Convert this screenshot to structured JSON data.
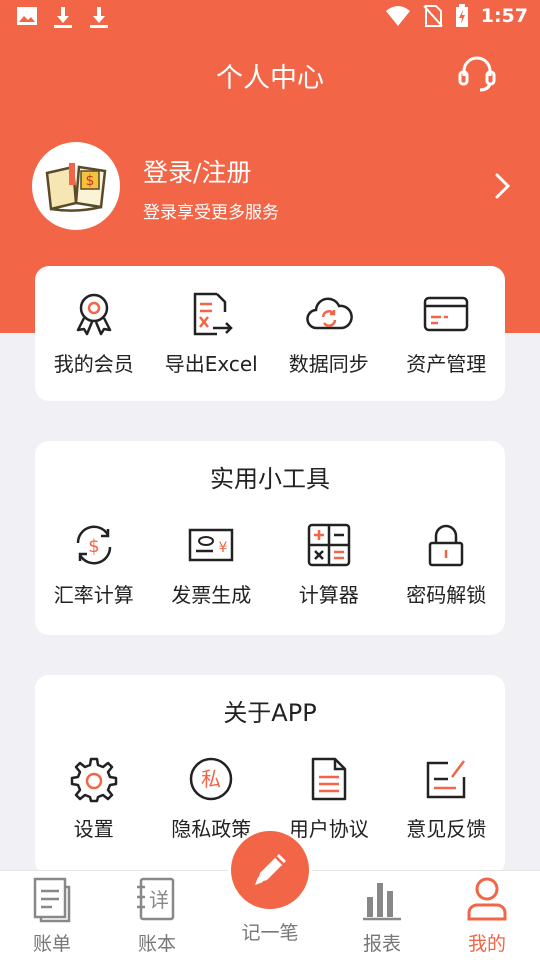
{
  "status_bar": {
    "time": "1:57"
  },
  "header": {
    "title": "个人中心"
  },
  "profile": {
    "login_label": "登录/注册",
    "login_sub": "登录享受更多服务"
  },
  "quick_actions": [
    {
      "label": "我的会员",
      "icon": "ribbon-badge-icon"
    },
    {
      "label": "导出Excel",
      "icon": "export-excel-icon"
    },
    {
      "label": "数据同步",
      "icon": "cloud-sync-icon"
    },
    {
      "label": "资产管理",
      "icon": "card-wallet-icon"
    }
  ],
  "tools": {
    "title": "实用小工具",
    "items": [
      {
        "label": "汇率计算",
        "icon": "currency-exchange-icon"
      },
      {
        "label": "发票生成",
        "icon": "invoice-icon"
      },
      {
        "label": "计算器",
        "icon": "calculator-icon"
      },
      {
        "label": "密码解锁",
        "icon": "lock-icon"
      }
    ]
  },
  "about": {
    "title": "关于APP",
    "items": [
      {
        "label": "设置",
        "icon": "gear-icon"
      },
      {
        "label": "隐私政策",
        "icon": "privacy-icon"
      },
      {
        "label": "用户协议",
        "icon": "document-icon"
      },
      {
        "label": "意见反馈",
        "icon": "feedback-icon"
      }
    ],
    "privacy_glyph": "私"
  },
  "tabbar": {
    "items": [
      {
        "label": "账单",
        "icon": "bill-icon"
      },
      {
        "label": "账本",
        "icon": "ledger-icon"
      },
      {
        "label": "记一笔",
        "icon": "pencil-icon"
      },
      {
        "label": "报表",
        "icon": "bar-chart-icon"
      },
      {
        "label": "我的",
        "icon": "person-icon"
      }
    ],
    "active": "我的",
    "ledger_glyph": "详"
  },
  "colors": {
    "accent": "#f26547",
    "background": "#f1f1f5",
    "card": "#ffffff",
    "text": "#222222",
    "tab_inactive": "#777777"
  }
}
